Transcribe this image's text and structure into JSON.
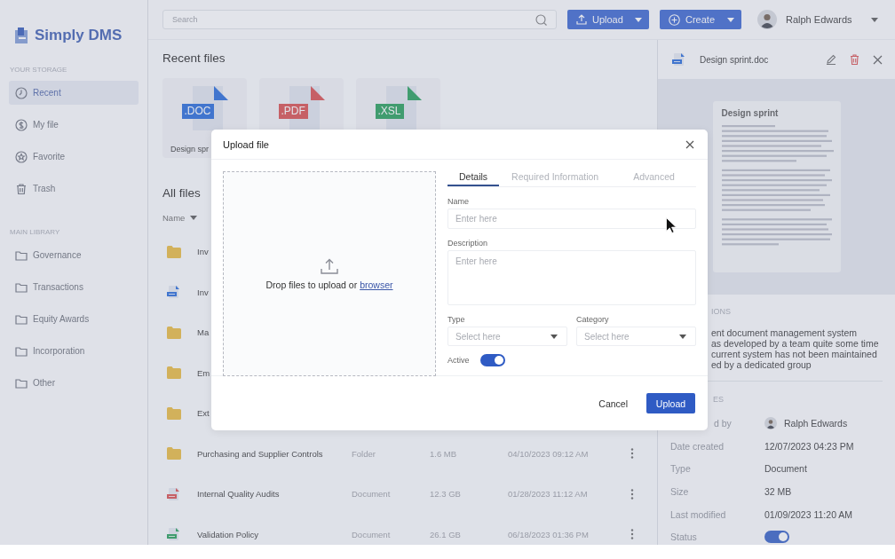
{
  "sidebar": {
    "logo": "Simply DMS",
    "sections": [
      {
        "heading": "YOUR STORAGE",
        "items": [
          {
            "label": "Recent",
            "kind": "clock",
            "selected": true
          },
          {
            "label": "My file",
            "kind": "coin",
            "selected": false
          },
          {
            "label": "Favorite",
            "kind": "star",
            "selected": false
          },
          {
            "label": "Trash",
            "kind": "trash",
            "selected": false
          }
        ]
      },
      {
        "heading": "MAIN LIBRARY",
        "items": [
          {
            "label": "Governance",
            "kind": "folder",
            "selected": false
          },
          {
            "label": "Transactions",
            "kind": "folder",
            "selected": false
          },
          {
            "label": "Equity Awards",
            "kind": "folder",
            "selected": false
          },
          {
            "label": "Incorporation",
            "kind": "folder",
            "selected": false
          },
          {
            "label": "Other",
            "kind": "folder",
            "selected": false
          }
        ]
      }
    ]
  },
  "topbar": {
    "search": {
      "placeholder": "Search"
    },
    "buttons": [
      {
        "label": "Upload",
        "kind": "upload"
      },
      {
        "label": "Create",
        "kind": "create"
      }
    ],
    "user": {
      "name": "Ralph Edwards"
    }
  },
  "recent_files": {
    "title": "Recent files",
    "cards": [
      {
        "ext": ".DOC",
        "kind": "doc",
        "name": "Design spr"
      },
      {
        "ext": ".PDF",
        "kind": "pdf"
      },
      {
        "ext": ".XSL",
        "kind": "xsl"
      }
    ]
  },
  "all_files": {
    "title": "All files",
    "sort_column": "Name",
    "rows": [
      {
        "name": "Inv",
        "kind": "folder"
      },
      {
        "name": "Inv",
        "kind": "doc"
      },
      {
        "name": "Ma",
        "kind": "folder"
      },
      {
        "name": "Em",
        "kind": "folder"
      },
      {
        "name": "Ext",
        "kind": "folder"
      },
      {
        "name": "Purchasing and Supplier Controls",
        "kind": "folder",
        "type": "Folder",
        "size": "1.6 MB",
        "modified": "04/10/2023 09:12 AM"
      },
      {
        "name": "Internal Quality Audits",
        "kind": "pdf",
        "type": "Document",
        "size": "12.3 GB",
        "modified": "01/28/2023 11:12 AM"
      },
      {
        "name": "Validation Policy",
        "kind": "xsl",
        "type": "Document",
        "size": "26.1 GB",
        "modified": "06/18/2023 01:36 PM"
      }
    ]
  },
  "details_panel": {
    "file_name": "Design sprint.doc",
    "preview": {
      "title": "Design sprint"
    },
    "description": {
      "heading": "IONS",
      "lines": [
        "ent document management system",
        "as developed by a team quite some time",
        "current system has not been maintained",
        "ed by a dedicated group"
      ]
    },
    "properties": {
      "heading": "ES",
      "rows": [
        {
          "label": "d by",
          "kind": "user",
          "value": "Ralph Edwards"
        },
        {
          "label": "Date created",
          "kind": "text",
          "value": "12/07/2023 04:23 PM"
        },
        {
          "label": "Type",
          "kind": "text",
          "value": "Document"
        },
        {
          "label": "Size",
          "kind": "text",
          "value": "32 MB"
        },
        {
          "label": "Last modified",
          "kind": "text",
          "value": "01/09/2023 11:20 AM"
        },
        {
          "label": "Status",
          "kind": "toggle",
          "on": true
        }
      ]
    }
  },
  "upload_dialog": {
    "title": "Upload file",
    "dropzone": {
      "text": "Drop files to upload or ",
      "link": "browser"
    },
    "tabs": [
      {
        "label": "Details",
        "selected": true
      },
      {
        "label": "Required Information",
        "selected": false
      },
      {
        "label": "Advanced",
        "selected": false
      }
    ],
    "fields": [
      {
        "label": "Name",
        "kind": "text",
        "placeholder": "Enter here"
      },
      {
        "label": "Description",
        "kind": "textarea",
        "placeholder": "Enter here"
      },
      {
        "label": "Type",
        "kind": "select",
        "placeholder": "Select here"
      },
      {
        "label": "Category",
        "kind": "select",
        "placeholder": "Select here"
      },
      {
        "label": "Active",
        "kind": "toggle",
        "on": true
      }
    ],
    "buttons": [
      {
        "label": "Cancel",
        "kind": "secondary"
      },
      {
        "label": "Upload",
        "kind": "primary"
      }
    ]
  }
}
